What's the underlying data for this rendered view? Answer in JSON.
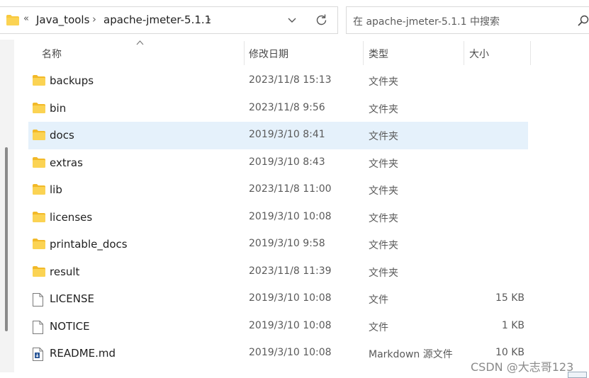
{
  "address_bar": {
    "crumbs": [
      "Java_tools",
      "apache-jmeter-5.1.1"
    ],
    "overflow_glyph": "«",
    "separator_glyph": "›"
  },
  "search": {
    "placeholder": "在 apache-jmeter-5.1.1 中搜索"
  },
  "columns": {
    "name": "名称",
    "date": "修改日期",
    "type": "类型",
    "size": "大小"
  },
  "files": [
    {
      "name": "backups",
      "date": "2023/11/8 15:13",
      "type": "文件夹",
      "size": "",
      "icon": "folder-icon"
    },
    {
      "name": "bin",
      "date": "2023/11/8 9:56",
      "type": "文件夹",
      "size": "",
      "icon": "folder-icon"
    },
    {
      "name": "docs",
      "date": "2019/3/10 8:41",
      "type": "文件夹",
      "size": "",
      "icon": "folder-icon",
      "selected": true
    },
    {
      "name": "extras",
      "date": "2019/3/10 8:43",
      "type": "文件夹",
      "size": "",
      "icon": "folder-icon"
    },
    {
      "name": "lib",
      "date": "2023/11/8 11:00",
      "type": "文件夹",
      "size": "",
      "icon": "folder-icon"
    },
    {
      "name": "licenses",
      "date": "2019/3/10 10:08",
      "type": "文件夹",
      "size": "",
      "icon": "folder-icon"
    },
    {
      "name": "printable_docs",
      "date": "2019/3/10 9:58",
      "type": "文件夹",
      "size": "",
      "icon": "folder-icon"
    },
    {
      "name": "result",
      "date": "2023/11/8 11:39",
      "type": "文件夹",
      "size": "",
      "icon": "folder-icon"
    },
    {
      "name": "LICENSE",
      "date": "2019/3/10 10:08",
      "type": "文件",
      "size": "15 KB",
      "icon": "file-icon"
    },
    {
      "name": "NOTICE",
      "date": "2019/3/10 10:08",
      "type": "文件",
      "size": "1 KB",
      "icon": "file-icon"
    },
    {
      "name": "README.md",
      "date": "2019/3/10 10:08",
      "type": "Markdown 源文件",
      "size": "10 KB",
      "icon": "markdown-file-icon"
    }
  ],
  "watermark": "CSDN @大志哥123",
  "colors": {
    "folder": "#f8c93e",
    "selected_row": "#e5f1fb",
    "scroll_thumb": "#8a8a8a"
  }
}
